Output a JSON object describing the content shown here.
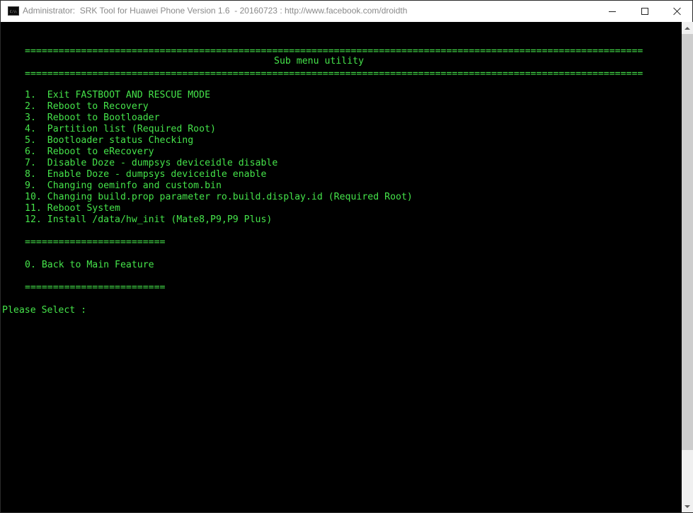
{
  "window": {
    "title": "Administrator:  SRK Tool for Huawei Phone Version 1.6  - 20160723 : http://www.facebook.com/droidth",
    "icon_text": "C:\\\\"
  },
  "console": {
    "separator_long": "==============================================================================================================",
    "heading": "Sub menu utility",
    "menu_items": [
      "1.  Exit FASTBOOT AND RESCUE MODE",
      "2.  Reboot to Recovery",
      "3.  Reboot to Bootloader",
      "4.  Partition list (Required Root)",
      "5.  Bootloader status Checking",
      "6.  Reboot to eRecovery",
      "7.  Disable Doze - dumpsys deviceidle disable",
      "8.  Enable Doze - dumpsys deviceidle enable",
      "9.  Changing oeminfo and custom.bin",
      "10. Changing build.prop parameter ro.build.display.id (Required Root)",
      "11. Reboot System",
      "12. Install /data/hw_init (Mate8,P9,P9 Plus)"
    ],
    "separator_short": "=========================",
    "back_item": "0. Back to Main Feature",
    "prompt": "Please Select :"
  },
  "colors": {
    "console_bg": "#000000",
    "console_text": "#45e34a",
    "titlebar_bg": "#ffffff"
  },
  "icons": [
    "console-app-icon",
    "minimize-icon",
    "maximize-icon",
    "close-icon",
    "scroll-up-arrow-icon",
    "scroll-down-arrow-icon"
  ]
}
